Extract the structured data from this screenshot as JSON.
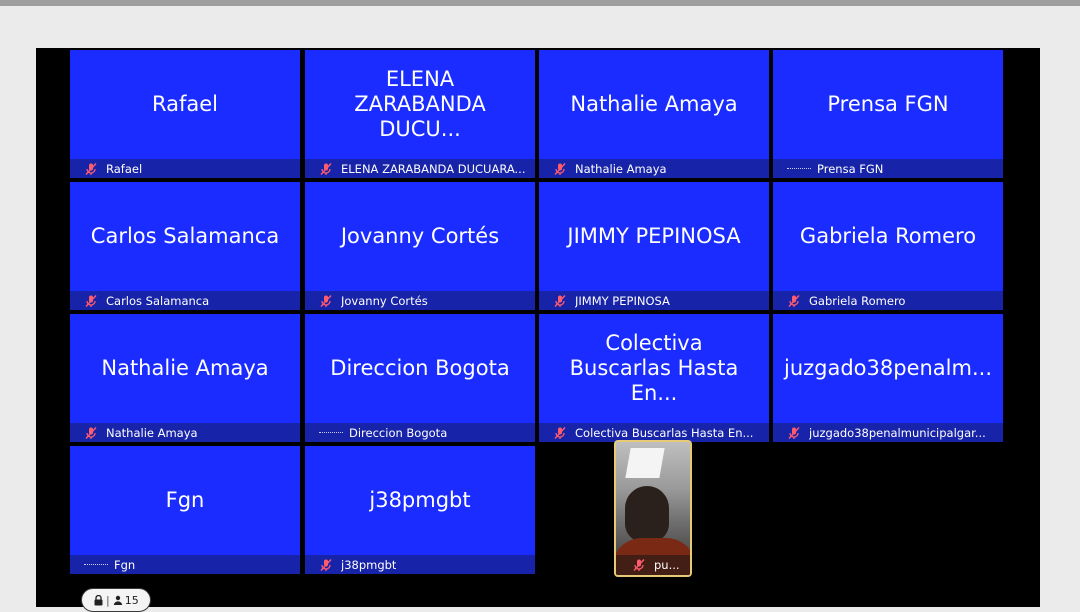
{
  "meeting": {
    "participant_count": "15",
    "tiles": [
      {
        "display_name": "Rafael",
        "label": "Rafael",
        "status_icon": "mic-off-icon"
      },
      {
        "display_name": "ELENA\nZARABANDA DUCU...",
        "label": "ELENA ZARABANDA DUCUARA...",
        "status_icon": "mic-off-icon"
      },
      {
        "display_name": "Nathalie Amaya",
        "label": "Nathalie Amaya",
        "status_icon": "mic-off-icon"
      },
      {
        "display_name": "Prensa FGN",
        "label": "Prensa FGN",
        "status_icon": "audio-bars-icon"
      },
      {
        "display_name": "Carlos Salamanca",
        "label": "Carlos Salamanca",
        "status_icon": "mic-off-icon"
      },
      {
        "display_name": "Jovanny Cortés",
        "label": "Jovanny Cortés",
        "status_icon": "mic-off-icon"
      },
      {
        "display_name": "JIMMY PEPINOSA",
        "label": "JIMMY PEPINOSA",
        "status_icon": "mic-off-icon"
      },
      {
        "display_name": "Gabriela Romero",
        "label": "Gabriela Romero",
        "status_icon": "mic-off-icon"
      },
      {
        "display_name": "Nathalie Amaya",
        "label": "Nathalie Amaya",
        "status_icon": "mic-off-icon"
      },
      {
        "display_name": "Direccion Bogota",
        "label": "Direccion Bogota",
        "status_icon": "audio-bars-icon"
      },
      {
        "display_name": "Colectiva\nBuscarlas Hasta En...",
        "label": "Colectiva Buscarlas Hasta En...",
        "status_icon": "mic-off-icon"
      },
      {
        "display_name": "juzgado38penalm...",
        "label": "juzgado38penalmunicipalgar...",
        "status_icon": "mic-off-icon"
      },
      {
        "display_name": "Fgn",
        "label": "Fgn",
        "status_icon": "audio-bars-icon"
      },
      {
        "display_name": "j38pmgbt",
        "label": "j38pmgbt",
        "status_icon": "mic-off-icon"
      }
    ],
    "self_view": {
      "label": "pu...",
      "status_icon": "mic-off-icon",
      "highlight_color": "#e7c978"
    }
  },
  "colors": {
    "tile_background": "#1a2cff",
    "nameplate_background": "#1723a8",
    "mic_off": "#ff5b6e",
    "stage_background": "#000000"
  }
}
